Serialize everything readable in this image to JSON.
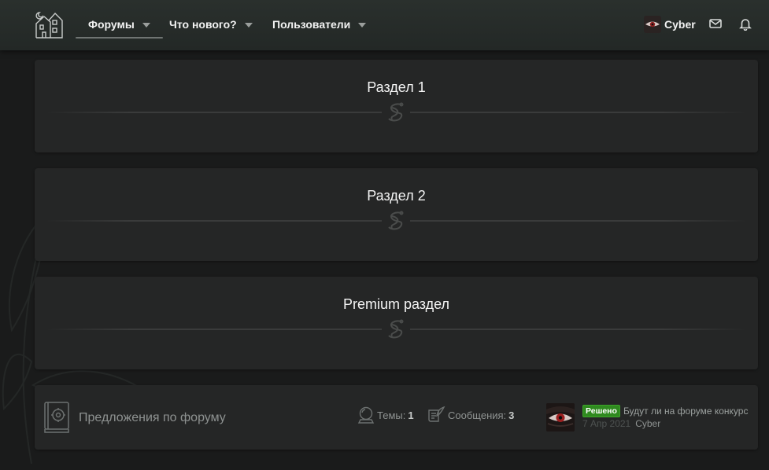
{
  "nav": {
    "tabs": [
      {
        "label": "Форумы"
      },
      {
        "label": "Что нового?"
      },
      {
        "label": "Пользователи"
      }
    ],
    "user": {
      "name": "Cyber"
    },
    "icons": {
      "logo": "haunted-house-icon",
      "messages": "envelope-icon",
      "alerts": "bell-icon"
    }
  },
  "categories": [
    {
      "title": "Раздел 1"
    },
    {
      "title": "Раздел 2"
    },
    {
      "title": "Premium раздел"
    }
  ],
  "forum": {
    "title": "Предложения по форуму",
    "topics_label": "Темы:",
    "topics_value": "1",
    "messages_label": "Сообщения:",
    "messages_value": "3",
    "last_post": {
      "badge": "Решено",
      "title": "Будут ли на форуме конкурс",
      "date": "7 Апр 2021",
      "user": "Cyber"
    }
  },
  "colors": {
    "background": "#1a1b1b",
    "panel": "#252626",
    "header": "#262b29",
    "badge": "#2f8a1f"
  }
}
